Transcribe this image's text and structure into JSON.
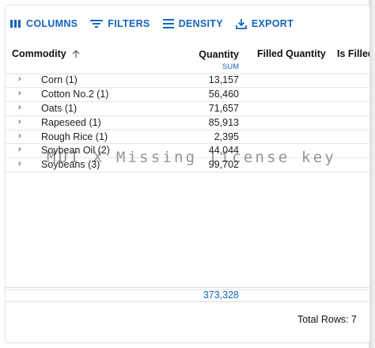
{
  "toolbar": {
    "columns_label": "COLUMNS",
    "filters_label": "FILTERS",
    "density_label": "DENSITY",
    "export_label": "EXPORT"
  },
  "header": {
    "commodity": "Commodity",
    "quantity": "Quantity",
    "quantity_agg": "SUM",
    "filled_quantity": "Filled Quantity",
    "is_filled": "Is Filled"
  },
  "rows": [
    {
      "commodity": "Corn (1)",
      "quantity": "13,157"
    },
    {
      "commodity": "Cotton No.2 (1)",
      "quantity": "56,460"
    },
    {
      "commodity": "Oats (1)",
      "quantity": "71,657"
    },
    {
      "commodity": "Rapeseed (1)",
      "quantity": "85,913"
    },
    {
      "commodity": "Rough Rice (1)",
      "quantity": "2,395"
    },
    {
      "commodity": "Soybean Oil (2)",
      "quantity": "44,044"
    },
    {
      "commodity": "Soybeans (3)",
      "quantity": "99,702"
    }
  ],
  "footer": {
    "total_quantity": "373,328",
    "total_rows": "Total Rows: 7"
  },
  "watermark": "MUI X Missing license key",
  "colors": {
    "accent": "#1565c0",
    "border": "#e0e0e0"
  },
  "icons": [
    "columns-icon",
    "filter-icon",
    "density-icon",
    "export-icon",
    "sort-arrow-icon",
    "chevron-right-icon"
  ]
}
